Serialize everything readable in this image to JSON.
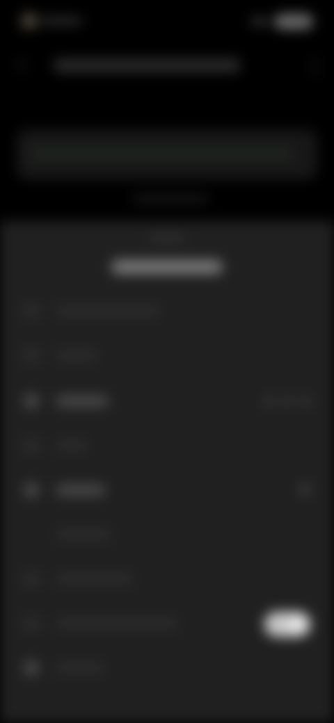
{
  "status_bar": {
    "time": "",
    "icons": [
      "signal-icon",
      "wifi-icon",
      "battery-icon"
    ]
  },
  "header": {
    "title": "",
    "back_icon": "chevron-left-icon",
    "more_icon": "more-vertical-icon"
  },
  "preview": {
    "text": "",
    "caption": ""
  },
  "sheet": {
    "title": "",
    "items": [
      {
        "label": "",
        "icon": "item-icon"
      },
      {
        "label": "",
        "icon": "item-icon"
      },
      {
        "label": "",
        "icon": "item-icon",
        "trailing": "dots"
      },
      {
        "label": "",
        "icon": "item-icon"
      },
      {
        "label": "",
        "icon": "item-icon",
        "trailing": "chevron"
      },
      {
        "label": "",
        "icon": "item-icon"
      },
      {
        "label": "",
        "icon": "item-icon"
      },
      {
        "label": "",
        "icon": "item-icon",
        "trailing": "toggle",
        "toggle_on": true
      },
      {
        "label": "",
        "icon": "item-icon"
      }
    ]
  },
  "colors": {
    "background": "#000000",
    "sheet": "#202020",
    "toggle_on": "#c8c8c8"
  }
}
